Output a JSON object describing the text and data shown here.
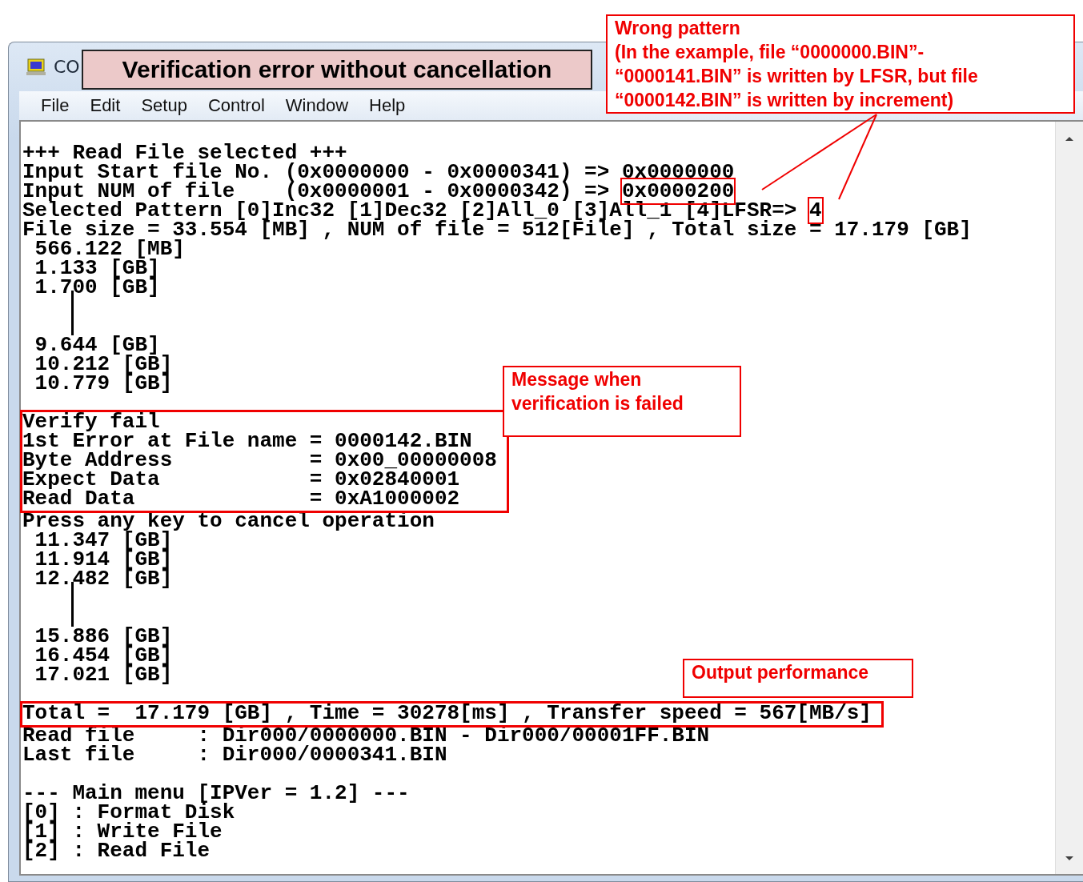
{
  "window": {
    "title": "CO"
  },
  "title_banner": "Verification error without cancellation",
  "menu": [
    "File",
    "Edit",
    "Setup",
    "Control",
    "Window",
    "Help"
  ],
  "terminal": {
    "lines": [
      {
        "kind": "text",
        "text": "+++ Read File selected +++"
      },
      {
        "kind": "text",
        "text": "Input Start file No. (0x0000000 - 0x0000341) => 0x0000000"
      },
      {
        "kind": "text",
        "text": "Input NUM of file    (0x0000001 - 0x0000342) => ",
        "boxed": "0x0000200"
      },
      {
        "kind": "text",
        "text": "Selected Pattern [0]Inc32 [1]Dec32 [2]All_0 [3]All_1 [4]LFSR=> ",
        "boxed": "4"
      },
      {
        "kind": "text",
        "text": "File size = 33.554 [MB] , NUM of file = 512[File] , Total size = 17.179 [GB]"
      },
      {
        "kind": "text",
        "text": " 566.122 [MB]"
      },
      {
        "kind": "text",
        "text": " 1.133 [GB]"
      },
      {
        "kind": "text",
        "text": " 1.700 [GB]"
      },
      {
        "kind": "gap"
      },
      {
        "kind": "text",
        "text": " 9.644 [GB]"
      },
      {
        "kind": "text",
        "text": " 10.212 [GB]"
      },
      {
        "kind": "text",
        "text": " 10.779 [GB]"
      },
      {
        "kind": "blank"
      },
      {
        "kind": "group",
        "lines": [
          "Verify fail",
          "1st Error at File name = 0000142.BIN",
          "Byte Address           = 0x00_00000008",
          "Expect Data            = 0x02840001",
          "Read Data              = 0xA1000002"
        ]
      },
      {
        "kind": "text",
        "text": "Press any key to cancel operation"
      },
      {
        "kind": "text",
        "text": " 11.347 [GB]"
      },
      {
        "kind": "text",
        "text": " 11.914 [GB]"
      },
      {
        "kind": "text",
        "text": " 12.482 [GB]"
      },
      {
        "kind": "gap"
      },
      {
        "kind": "text",
        "text": " 15.886 [GB]"
      },
      {
        "kind": "text",
        "text": " 16.454 [GB]"
      },
      {
        "kind": "text",
        "text": " 17.021 [GB]"
      },
      {
        "kind": "blank"
      },
      {
        "kind": "group",
        "lines": [
          "Total =  17.179 [GB] , Time = 30278[ms] , Transfer speed = 567[MB/s]"
        ]
      },
      {
        "kind": "text",
        "text": "Read file     : Dir000/0000000.BIN - Dir000/00001FF.BIN"
      },
      {
        "kind": "text",
        "text": "Last file     : Dir000/0000341.BIN"
      },
      {
        "kind": "blank"
      },
      {
        "kind": "text",
        "text": "--- Main menu [IPVer = 1.2] ---"
      },
      {
        "kind": "text",
        "text": "[0] : Format Disk"
      },
      {
        "kind": "text",
        "text": "[1] : Write File"
      },
      {
        "kind": "text",
        "text": "[2] : Read File"
      }
    ]
  },
  "callouts": [
    {
      "lines": [
        "Wrong pattern",
        "(In the example, file “0000000.BIN”-",
        "“0000141.BIN” is written by LFSR, but file",
        "“0000142.BIN” is written by increment)"
      ]
    },
    {
      "lines": [
        "Message when",
        "verification is failed"
      ]
    },
    {
      "lines": [
        "Output performance"
      ]
    }
  ]
}
